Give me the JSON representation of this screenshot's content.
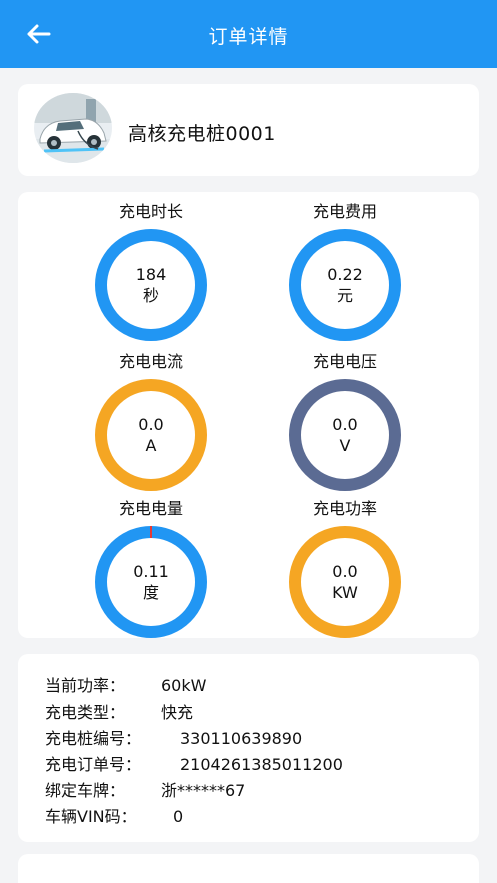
{
  "header": {
    "title": "订单详情",
    "back_icon": "arrow-left-icon",
    "background": "#2196f3"
  },
  "station": {
    "name": "高核充电桩0001",
    "thumbnail_icon": "car-charging-icon"
  },
  "gauges": {
    "duration": {
      "label": "充电时长",
      "value": "184",
      "unit": "秒",
      "color": "#2196f3"
    },
    "cost": {
      "label": "充电费用",
      "value": "0.22",
      "unit": "元",
      "color": "#2196f3"
    },
    "current": {
      "label": "充电电流",
      "value": "0.0",
      "unit": "A",
      "color": "#f5a623"
    },
    "voltage": {
      "label": "充电电压",
      "value": "0.0",
      "unit": "V",
      "color": "#5b6b93"
    },
    "energy": {
      "label": "充电电量",
      "value": "0.11",
      "unit": "度",
      "color": "#2196f3"
    },
    "power": {
      "label": "充电功率",
      "value": "0.0",
      "unit": "KW",
      "color": "#f5a623"
    }
  },
  "info": {
    "rows": [
      {
        "label": "当前功率：",
        "value": "60kW"
      },
      {
        "label": "充电类型：",
        "value": "快充"
      },
      {
        "label": "充电桩编号：",
        "value": "330110639890"
      },
      {
        "label": "充电订单号：",
        "value": "2104261385011200"
      },
      {
        "label": "绑定车牌：",
        "value": "浙******67"
      },
      {
        "label": "车辆VIN码：",
        "value": "0"
      }
    ]
  }
}
